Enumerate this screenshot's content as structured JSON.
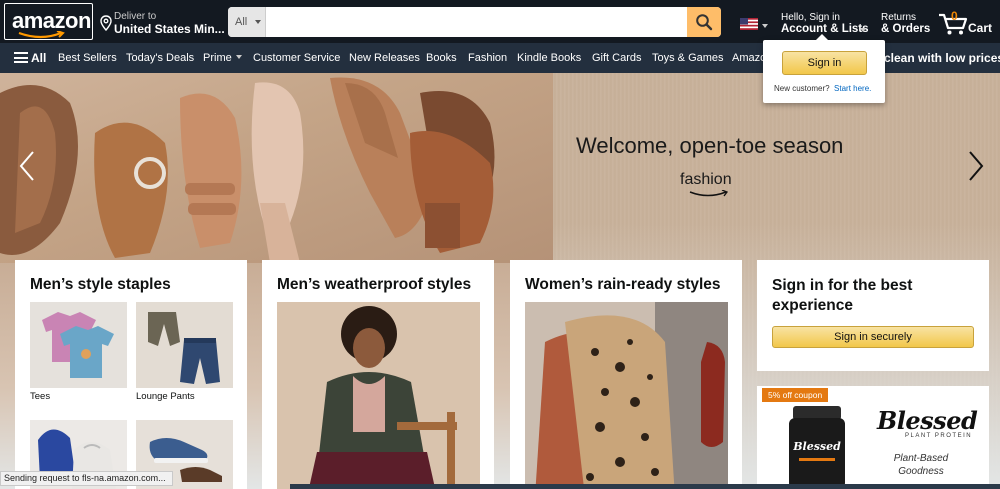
{
  "header": {
    "logo_text": "amazon",
    "deliver_line1": "Deliver to",
    "deliver_line2": "United States Min...",
    "search_category": "All",
    "search_placeholder": "",
    "flag": "us-flag-icon",
    "account_line1": "Hello, Sign in",
    "account_line2": "Account & Lists",
    "returns_line1": "Returns",
    "returns_line2": "& Orders",
    "cart_count": "0",
    "cart_label": "Cart"
  },
  "subnav": {
    "all_label": "All",
    "items": [
      "Best Sellers",
      "Today's Deals",
      "Prime",
      "Customer Service",
      "New Releases",
      "Books",
      "Fashion",
      "Kindle Books",
      "Gift Cards",
      "Toys & Games",
      "Amazo"
    ],
    "promo": "clean with low prices"
  },
  "flyout": {
    "sign_in_label": "Sign in",
    "new_customer_text": "New customer?",
    "start_here_link": "Start here."
  },
  "hero": {
    "headline": "Welcome, open-toe season",
    "brand": "fashion"
  },
  "cards": {
    "mens_staples": {
      "title": "Men’s style staples",
      "tiles": [
        {
          "label": "Tees"
        },
        {
          "label": "Lounge Pants"
        },
        {
          "label": ""
        },
        {
          "label": ""
        }
      ]
    },
    "mens_weather": {
      "title": "Men’s weatherproof styles"
    },
    "womens_rain": {
      "title": "Women’s rain-ready styles"
    },
    "signin": {
      "title": "Sign in for the best experience",
      "button": "Sign in securely"
    },
    "ad": {
      "coupon": "5% off coupon",
      "brand": "Blessed",
      "sub": "PLANT PROTEIN",
      "desc": "Plant-Based Goodness"
    }
  },
  "status_bar": "Sending request to fls-na.amazon.com...",
  "colors": {
    "nav_dark": "#131921",
    "nav_sub": "#232f3e",
    "search_button": "#febd69",
    "cart_count": "#f08804",
    "link": "#0066c0",
    "coupon": "#e47911"
  }
}
